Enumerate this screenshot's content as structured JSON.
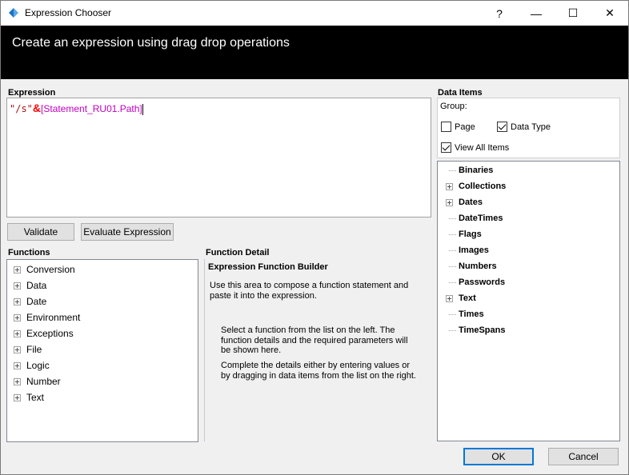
{
  "window": {
    "title": "Expression Chooser",
    "help_glyph": "?",
    "min_glyph": "—",
    "max_glyph": "☐",
    "close_glyph": "✕"
  },
  "banner": {
    "text": "Create an expression using drag drop operations"
  },
  "expression": {
    "label": "Expression",
    "string_part": "\"/s\"",
    "operator": "&",
    "item_part": "[Statement_RU01.Path]"
  },
  "buttons": {
    "validate": "Validate",
    "evaluate": "Evaluate Expression",
    "ok": "OK",
    "cancel": "Cancel"
  },
  "functions": {
    "label": "Functions",
    "items": [
      "Conversion",
      "Data",
      "Date",
      "Environment",
      "Exceptions",
      "File",
      "Logic",
      "Number",
      "Text"
    ]
  },
  "function_detail": {
    "label": "Function Detail",
    "title": "Expression Function Builder",
    "para1": "Use this area to compose a function statement and paste it into the expression.",
    "para2": "Select a function from the list on the left. The function details and the required parameters will be shown here.",
    "para3": "Complete the details either by entering values or by dragging in data items from the list on the right."
  },
  "data_items": {
    "label": "Data Items",
    "group_label": "Group:",
    "page": {
      "label": "Page",
      "checked": false
    },
    "data_type": {
      "label": "Data Type",
      "checked": true
    },
    "view_all": {
      "label": "View All Items",
      "checked": true
    },
    "items": [
      {
        "label": "Binaries",
        "expandable": false
      },
      {
        "label": "Collections",
        "expandable": true
      },
      {
        "label": "Dates",
        "expandable": true
      },
      {
        "label": "DateTimes",
        "expandable": false
      },
      {
        "label": "Flags",
        "expandable": false
      },
      {
        "label": "Images",
        "expandable": false
      },
      {
        "label": "Numbers",
        "expandable": false
      },
      {
        "label": "Passwords",
        "expandable": false
      },
      {
        "label": "Text",
        "expandable": true
      },
      {
        "label": "Times",
        "expandable": false
      },
      {
        "label": "TimeSpans",
        "expandable": false
      }
    ]
  },
  "colors": {
    "banner_bg": "#000000",
    "string_color": "#a31515",
    "operator_color": "#ff0000",
    "item_color": "#c000c0"
  }
}
